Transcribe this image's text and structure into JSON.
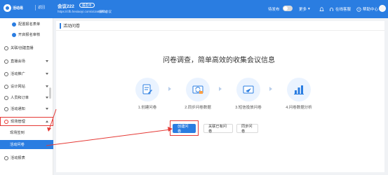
{
  "topbar": {
    "logo_text": "活动易",
    "back_label": "返回",
    "meeting_title": "会议222",
    "meeting_badge": "报名中",
    "meeting_url": "https://cfb.hexiaoyi.com/a/Ja6ciFnq",
    "edit_label": "编辑会议",
    "publish_label": "待发布",
    "more_label": "更多",
    "service_label": "在线客服",
    "help_label": "帮助中心"
  },
  "sidebar": {
    "items": [
      {
        "label": "配置报名表单"
      },
      {
        "label": "开启报名审核"
      },
      {
        "label": "关联/创建直播"
      },
      {
        "label": "直播会场"
      },
      {
        "label": "活动推广"
      },
      {
        "label": "设计网站"
      },
      {
        "label": "人员和订单"
      },
      {
        "label": "活动通知"
      },
      {
        "label": "现场管理"
      },
      {
        "label": "现场签到"
      },
      {
        "label": "活动问卷"
      },
      {
        "label": "活动报表"
      }
    ]
  },
  "main": {
    "header_title": "活动问卷",
    "tagline": "问卷调查，简单高效的收集会议信息",
    "steps": [
      {
        "label": "1.创建问卷",
        "icon": "clipboard-edit-icon"
      },
      {
        "label": "2.同步问卷数据",
        "icon": "sync-data-icon"
      },
      {
        "label": "3.短信投放问卷",
        "icon": "sms-send-icon"
      },
      {
        "label": "4.问卷数据分析",
        "icon": "bar-chart-icon"
      }
    ],
    "buttons": {
      "create": "创建问卷",
      "link": "关联已有问卷",
      "sync": "同步问卷"
    }
  },
  "colors": {
    "primary": "#2a7de1",
    "annotation": "#e53935",
    "step_bg": "#eaf3ff"
  }
}
